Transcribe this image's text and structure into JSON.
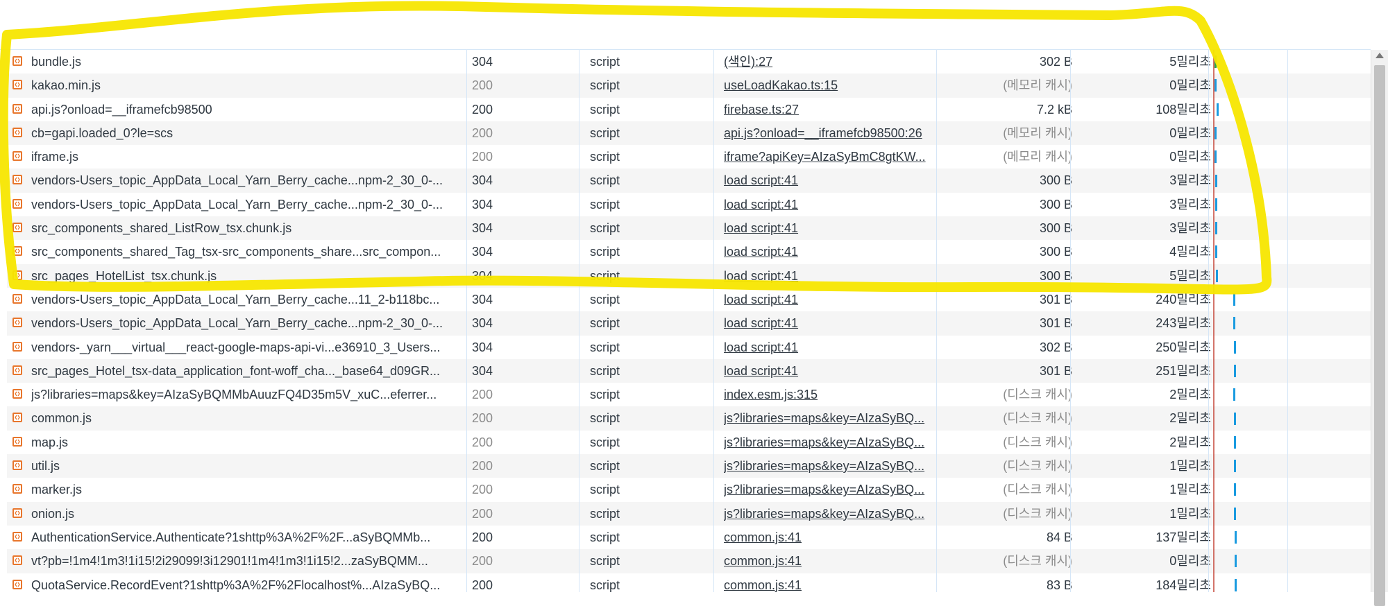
{
  "requests": [
    {
      "name": "bundle.js",
      "status": "304",
      "type": "script",
      "initiator": "(색인):27",
      "size": "302 B",
      "time": "5밀리초",
      "cached": false
    },
    {
      "name": "kakao.min.js",
      "status": "200",
      "type": "script",
      "initiator": "useLoadKakao.ts:15",
      "size": "(메모리 캐시)",
      "time": "0밀리초",
      "cached": true
    },
    {
      "name": "api.js?onload=__iframefcb98500",
      "status": "200",
      "type": "script",
      "initiator": "firebase.ts:27",
      "size": "7.2 kB",
      "time": "108밀리초",
      "cached": false
    },
    {
      "name": "cb=gapi.loaded_0?le=scs",
      "status": "200",
      "type": "script",
      "initiator": "api.js?onload=__iframefcb98500:26",
      "size": "(메모리 캐시)",
      "time": "0밀리초",
      "cached": true
    },
    {
      "name": "iframe.js",
      "status": "200",
      "type": "script",
      "initiator": "iframe?apiKey=AIzaSyBmC8gtKW...",
      "size": "(메모리 캐시)",
      "time": "0밀리초",
      "cached": true
    },
    {
      "name": "vendors-Users_topic_AppData_Local_Yarn_Berry_cache...npm-2_30_0-...",
      "status": "304",
      "type": "script",
      "initiator": "load script:41",
      "size": "300 B",
      "time": "3밀리초",
      "cached": false
    },
    {
      "name": "vendors-Users_topic_AppData_Local_Yarn_Berry_cache...npm-2_30_0-...",
      "status": "304",
      "type": "script",
      "initiator": "load script:41",
      "size": "300 B",
      "time": "3밀리초",
      "cached": false
    },
    {
      "name": "src_components_shared_ListRow_tsx.chunk.js",
      "status": "304",
      "type": "script",
      "initiator": "load script:41",
      "size": "300 B",
      "time": "3밀리초",
      "cached": false
    },
    {
      "name": "src_components_shared_Tag_tsx-src_components_share...src_compon...",
      "status": "304",
      "type": "script",
      "initiator": "load script:41",
      "size": "300 B",
      "time": "4밀리초",
      "cached": false
    },
    {
      "name": "src_pages_HotelList_tsx.chunk.js",
      "status": "304",
      "type": "script",
      "initiator": "load script:41",
      "size": "300 B",
      "time": "5밀리초",
      "cached": false
    },
    {
      "name": "vendors-Users_topic_AppData_Local_Yarn_Berry_cache...11_2-b118bc...",
      "status": "304",
      "type": "script",
      "initiator": "load script:41",
      "size": "301 B",
      "time": "240밀리초",
      "cached": false
    },
    {
      "name": "vendors-Users_topic_AppData_Local_Yarn_Berry_cache...npm-2_30_0-...",
      "status": "304",
      "type": "script",
      "initiator": "load script:41",
      "size": "301 B",
      "time": "243밀리초",
      "cached": false
    },
    {
      "name": "vendors-_yarn___virtual___react-google-maps-api-vi...e36910_3_Users...",
      "status": "304",
      "type": "script",
      "initiator": "load script:41",
      "size": "302 B",
      "time": "250밀리초",
      "cached": false
    },
    {
      "name": "src_pages_Hotel_tsx-data_application_font-woff_cha..._base64_d09GR...",
      "status": "304",
      "type": "script",
      "initiator": "load script:41",
      "size": "301 B",
      "time": "251밀리초",
      "cached": false
    },
    {
      "name": "js?libraries=maps&key=AIzaSyBQMMbAuuzFQ4D35m5V_xuC...eferrer...",
      "status": "200",
      "type": "script",
      "initiator": "index.esm.js:315",
      "size": "(디스크 캐시)",
      "time": "2밀리초",
      "cached": true
    },
    {
      "name": "common.js",
      "status": "200",
      "type": "script",
      "initiator": "js?libraries=maps&key=AIzaSyBQ...",
      "size": "(디스크 캐시)",
      "time": "2밀리초",
      "cached": true
    },
    {
      "name": "map.js",
      "status": "200",
      "type": "script",
      "initiator": "js?libraries=maps&key=AIzaSyBQ...",
      "size": "(디스크 캐시)",
      "time": "2밀리초",
      "cached": true
    },
    {
      "name": "util.js",
      "status": "200",
      "type": "script",
      "initiator": "js?libraries=maps&key=AIzaSyBQ...",
      "size": "(디스크 캐시)",
      "time": "1밀리초",
      "cached": true
    },
    {
      "name": "marker.js",
      "status": "200",
      "type": "script",
      "initiator": "js?libraries=maps&key=AIzaSyBQ...",
      "size": "(디스크 캐시)",
      "time": "1밀리초",
      "cached": true
    },
    {
      "name": "onion.js",
      "status": "200",
      "type": "script",
      "initiator": "js?libraries=maps&key=AIzaSyBQ...",
      "size": "(디스크 캐시)",
      "time": "1밀리초",
      "cached": true
    },
    {
      "name": "AuthenticationService.Authenticate?1shttp%3A%2F%2F...aSyBQMMb...",
      "status": "200",
      "type": "script",
      "initiator": "common.js:41",
      "size": "84 B",
      "time": "137밀리초",
      "cached": false
    },
    {
      "name": "vt?pb=!1m4!1m3!1i15!2i29099!3i12901!1m4!1m3!1i15!2...zaSyBQMM...",
      "status": "200",
      "type": "script",
      "initiator": "common.js:41",
      "size": "(디스크 캐시)",
      "time": "0밀리초",
      "cached": true
    },
    {
      "name": "QuotaService.RecordEvent?1shttp%3A%2F%2Flocalhost%...AIzaSyBQ...",
      "status": "200",
      "type": "script",
      "initiator": "common.js:41",
      "size": "83 B",
      "time": "184밀리초",
      "cached": false
    }
  ],
  "colors": {
    "highlight": "#f7e600",
    "file_icon": "#e8762c",
    "waterfall_green": "#2aa84a",
    "waterfall_blue": "#1a9be0",
    "waterfall_marker": "#c0392b"
  }
}
